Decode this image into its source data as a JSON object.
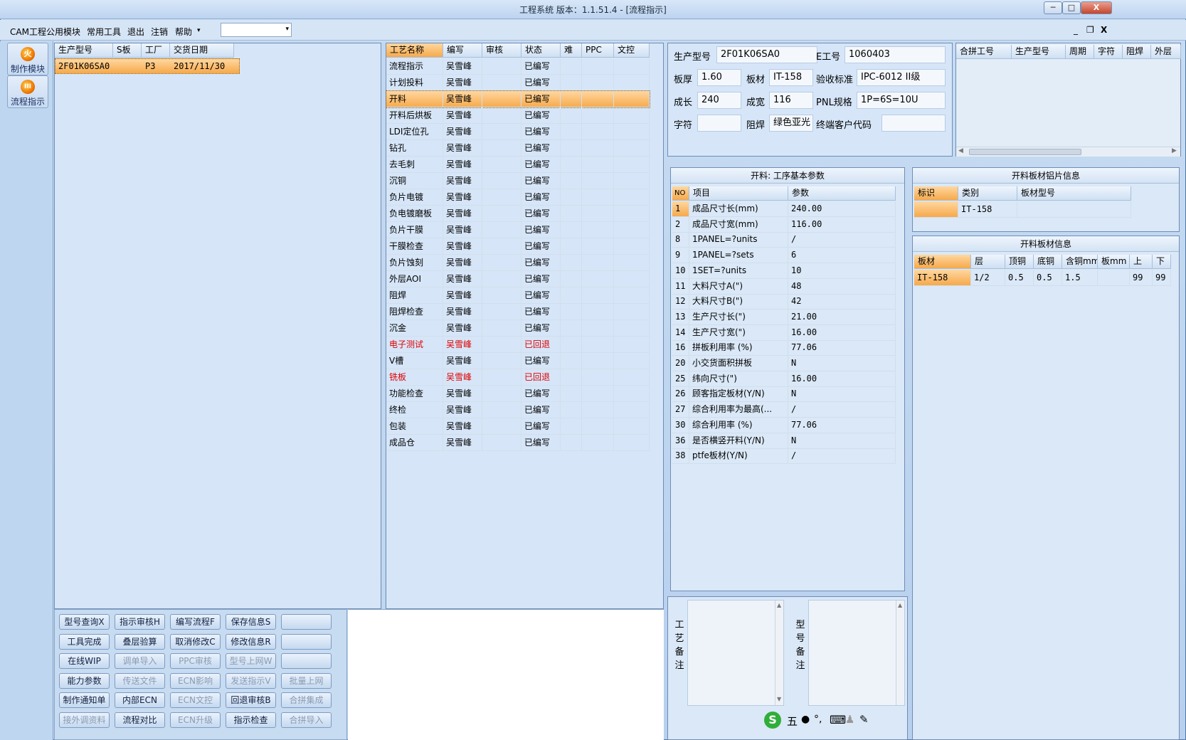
{
  "window": {
    "title": "工程系统   版本：1.1.51.4 - [流程指示]"
  },
  "window_controls": {
    "min": "─",
    "max": "□",
    "close": "X"
  },
  "menubar": {
    "items": [
      "CAM工程",
      "公用模块",
      "常用工具",
      "退出",
      "注销",
      "帮助"
    ],
    "help_arrow": "▾",
    "combo_value": "",
    "combo_arrow": "▾",
    "mdi_min": "_",
    "mdi_restore": "❐",
    "mdi_close": "X"
  },
  "leftbar": {
    "buttons": [
      {
        "label": "制作模块",
        "icon_glyph": "火"
      },
      {
        "label": "流程指示",
        "icon_glyph": "III"
      }
    ]
  },
  "order_grid": {
    "headers": [
      "生产型号",
      "S板",
      "工厂",
      "交货日期"
    ],
    "rows": [
      [
        "2F01K06SA0",
        "",
        "P3",
        "2017/11/30"
      ]
    ]
  },
  "process_grid": {
    "headers": [
      "工艺名称",
      "编写",
      "审核",
      "状态",
      "难",
      "PPC",
      "文控"
    ],
    "rows": [
      {
        "name": "流程指示",
        "writer": "吴雪峰",
        "status": "已编写"
      },
      {
        "name": "计划投料",
        "writer": "吴雪峰",
        "status": "已编写"
      },
      {
        "name": "开料",
        "writer": "吴雪峰",
        "status": "已编写"
      },
      {
        "name": "开料后烘板",
        "writer": "吴雪峰",
        "status": "已编写"
      },
      {
        "name": "LDI定位孔",
        "writer": "吴雪峰",
        "status": "已编写"
      },
      {
        "name": "钻孔",
        "writer": "吴雪峰",
        "status": "已编写"
      },
      {
        "name": "去毛刺",
        "writer": "吴雪峰",
        "status": "已编写"
      },
      {
        "name": "沉铜",
        "writer": "吴雪峰",
        "status": "已编写"
      },
      {
        "name": "负片电镀",
        "writer": "吴雪峰",
        "status": "已编写"
      },
      {
        "name": "负电镀磨板",
        "writer": "吴雪峰",
        "status": "已编写"
      },
      {
        "name": "负片干膜",
        "writer": "吴雪峰",
        "status": "已编写"
      },
      {
        "name": "干膜检查",
        "writer": "吴雪峰",
        "status": "已编写"
      },
      {
        "name": "负片蚀刻",
        "writer": "吴雪峰",
        "status": "已编写"
      },
      {
        "name": "外层AOI",
        "writer": "吴雪峰",
        "status": "已编写"
      },
      {
        "name": "阻焊",
        "writer": "吴雪峰",
        "status": "已编写"
      },
      {
        "name": "阻焊检查",
        "writer": "吴雪峰",
        "status": "已编写"
      },
      {
        "name": "沉金",
        "writer": "吴雪峰",
        "status": "已编写"
      },
      {
        "name": "电子测试",
        "writer": "吴雪峰",
        "status": "已回退"
      },
      {
        "name": "V槽",
        "writer": "吴雪峰",
        "status": "已编写"
      },
      {
        "name": "铣板",
        "writer": "吴雪峰",
        "status": "已回退"
      },
      {
        "name": "功能检查",
        "writer": "吴雪峰",
        "status": "已编写"
      },
      {
        "name": "终检",
        "writer": "吴雪峰",
        "status": "已编写"
      },
      {
        "name": "包装",
        "writer": "吴雪峰",
        "status": "已编写"
      },
      {
        "name": "成品仓",
        "writer": "吴雪峰",
        "status": "已编写"
      }
    ]
  },
  "info": {
    "model_label": "生产型号",
    "model_value": "2F01K06SA0",
    "eno_label": "E工号",
    "eno_value": "1060403",
    "thickness_label": "板厚",
    "thickness_value": "1.60",
    "material_label": "板材",
    "material_value": "IT-158",
    "standard_label": "验收标准",
    "standard_value": "IPC-6012 II级",
    "len_label": "成长",
    "len_value": "240",
    "wid_label": "成宽",
    "wid_value": "116",
    "pnl_label": "PNL规格",
    "pnl_value": "1P=6S=10U",
    "char_label": "字符",
    "char_value": "",
    "mask_label": "阻焊",
    "mask_value": "绿色亚光",
    "customer_label": "终端客户代码",
    "customer_value": ""
  },
  "merge_grid": {
    "headers": [
      "合拼工号",
      "生产型号",
      "周期",
      "字符",
      "阻焊",
      "外层"
    ],
    "scroll_left": "◀",
    "scroll_right": "▶"
  },
  "params": {
    "title": "开料: 工序基本参数",
    "headers": [
      "NO",
      "项目",
      "参数"
    ],
    "rows": [
      [
        "1",
        "成品尺寸长(mm)",
        "240.00"
      ],
      [
        "2",
        "成品尺寸宽(mm)",
        "116.00"
      ],
      [
        "8",
        "1PANEL=?units",
        "/"
      ],
      [
        "9",
        "1PANEL=?sets",
        "6"
      ],
      [
        "10",
        "1SET=?units",
        "10"
      ],
      [
        "11",
        "大料尺寸A(\")",
        "48"
      ],
      [
        "12",
        "大料尺寸B(\")",
        "42"
      ],
      [
        "13",
        "生产尺寸长(\")",
        "21.00"
      ],
      [
        "14",
        "生产尺寸宽(\")",
        "16.00"
      ],
      [
        "16",
        "拼板利用率 (%)",
        "77.06"
      ],
      [
        "20",
        "小交货面积拼板",
        "N"
      ],
      [
        "25",
        "纬向尺寸(\")",
        "16.00"
      ],
      [
        "26",
        "顾客指定板材(Y/N)",
        "N"
      ],
      [
        "27",
        "综合利用率为最高(...",
        "/"
      ],
      [
        "30",
        "综合利用率 (%)",
        "77.06"
      ],
      [
        "36",
        "是否横竖开料(Y/N)",
        "N"
      ],
      [
        "38",
        "ptfe板材(Y/N)",
        "/"
      ]
    ]
  },
  "foil_info": {
    "title": "开料板材铝片信息",
    "headers": [
      "标识",
      "类别",
      "板材型号"
    ],
    "rows": [
      [
        "",
        "IT-158",
        ""
      ]
    ]
  },
  "board_info": {
    "title": "开料板材信息",
    "headers": [
      "板材",
      "层",
      "顶铜",
      "底铜",
      "含铜mm",
      "板mm",
      "上",
      "下"
    ],
    "rows": [
      [
        "IT-158",
        "1/2",
        "0.5",
        "0.5",
        "1.5",
        "",
        "99",
        "99"
      ]
    ]
  },
  "remarks": {
    "process_label": "工艺备注",
    "model_label": "型号备注",
    "scroll_up": "▲",
    "scroll_down": "▼"
  },
  "buttons": [
    [
      "型号查询X",
      "指示审核H",
      "编写流程F",
      "保存信息S",
      ""
    ],
    [
      "工具完成",
      "叠层验算",
      "取消修改C",
      "修改信息R",
      ""
    ],
    [
      "在线WIP",
      "调单导入",
      "PPC审核",
      "型号上网W",
      ""
    ],
    [
      "能力参数",
      "传送文件",
      "ECN影响",
      "发送指示V",
      "批量上网"
    ],
    [
      "制作通知单",
      "内部ECN",
      "ECN文控",
      "回退审核B",
      "合拼集成"
    ],
    [
      "接外调资料",
      "流程对比",
      "ECN升级",
      "指示检查",
      "合拼导入"
    ]
  ],
  "buttons_disabled": [
    [
      false,
      false,
      false,
      false,
      false
    ],
    [
      false,
      false,
      false,
      false,
      false
    ],
    [
      false,
      true,
      true,
      true,
      false
    ],
    [
      false,
      true,
      true,
      true,
      true
    ],
    [
      false,
      false,
      true,
      false,
      true
    ],
    [
      true,
      false,
      true,
      false,
      true
    ]
  ],
  "ime": {
    "logo": "S",
    "mode": "五",
    "dot": "●",
    "punct": "°,",
    "keyboard": "⌨",
    "user": "♟",
    "wrench": "✎"
  }
}
